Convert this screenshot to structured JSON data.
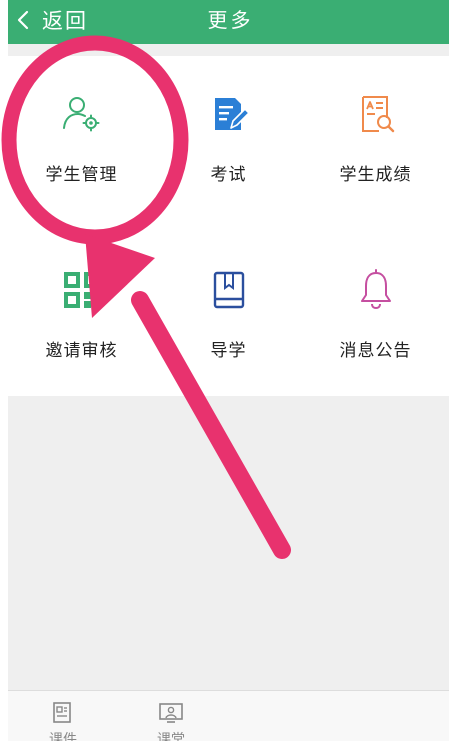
{
  "header": {
    "back_label": "返回",
    "title": "更多",
    "bg_color": "#3aae73"
  },
  "grid": {
    "items": [
      {
        "label": "学生管理",
        "icon": "student-settings-icon",
        "color": "#3aae73"
      },
      {
        "label": "考试",
        "icon": "exam-edit-icon",
        "color": "#2b7fd6"
      },
      {
        "label": "学生成绩",
        "icon": "grade-report-icon",
        "color": "#f08a4b"
      },
      {
        "label": "邀请审核",
        "icon": "qr-code-icon",
        "color": "#3aae73"
      },
      {
        "label": "导学",
        "icon": "book-icon",
        "color": "#2b4f9e"
      },
      {
        "label": "消息公告",
        "icon": "bell-icon",
        "color": "#c54fa0"
      }
    ]
  },
  "bottom_nav": {
    "tabs": [
      {
        "label": "课件",
        "icon": "courseware-icon"
      },
      {
        "label": "课堂",
        "icon": "classroom-icon"
      }
    ]
  },
  "annotation": {
    "color": "#e8326e"
  }
}
